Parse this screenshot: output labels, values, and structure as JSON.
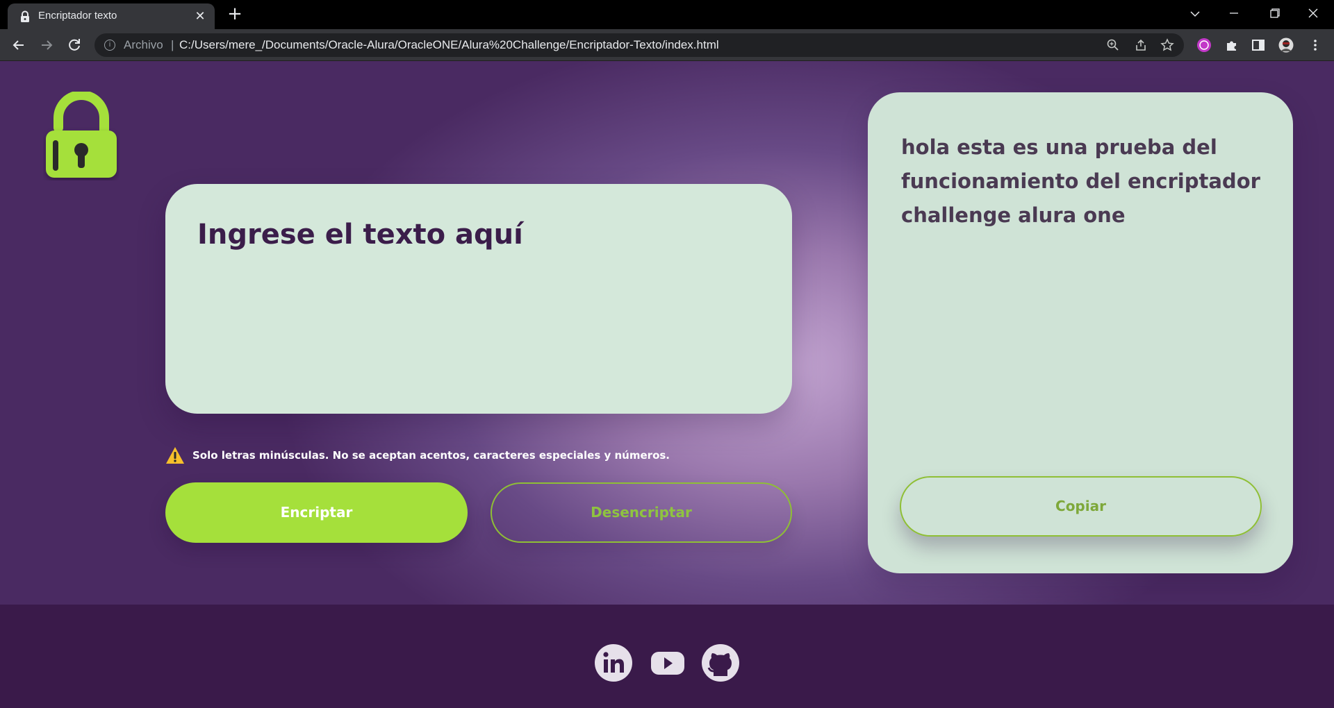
{
  "browser": {
    "tab_title": "Encriptador texto",
    "url_scheme": "Archivo",
    "url_separator": "|",
    "url": "C:/Users/mere_/Documents/Oracle-Alura/OracleONE/Alura%20Challenge/Encriptador-Texto/index.html",
    "new_tab_glyph": "+",
    "tab_close_glyph": "✕"
  },
  "app": {
    "input_placeholder": "Ingrese el texto aquí",
    "warning": "Solo letras minúsculas. No se aceptan acentos, caracteres especiales y números.",
    "encrypt_label": "Encriptar",
    "decrypt_label": "Desencriptar",
    "output_text": "hola esta es una prueba del funcionamiento del encriptador challenge alura one",
    "copy_label": "Copiar"
  },
  "footer": {
    "social": [
      "linkedin-icon",
      "youtube-icon",
      "github-icon"
    ]
  },
  "colors": {
    "accent_green": "#a5e03b",
    "card_bg": "#d4e8da",
    "dark_purple": "#3a1a4a",
    "text_purple": "#3b1d4a"
  }
}
